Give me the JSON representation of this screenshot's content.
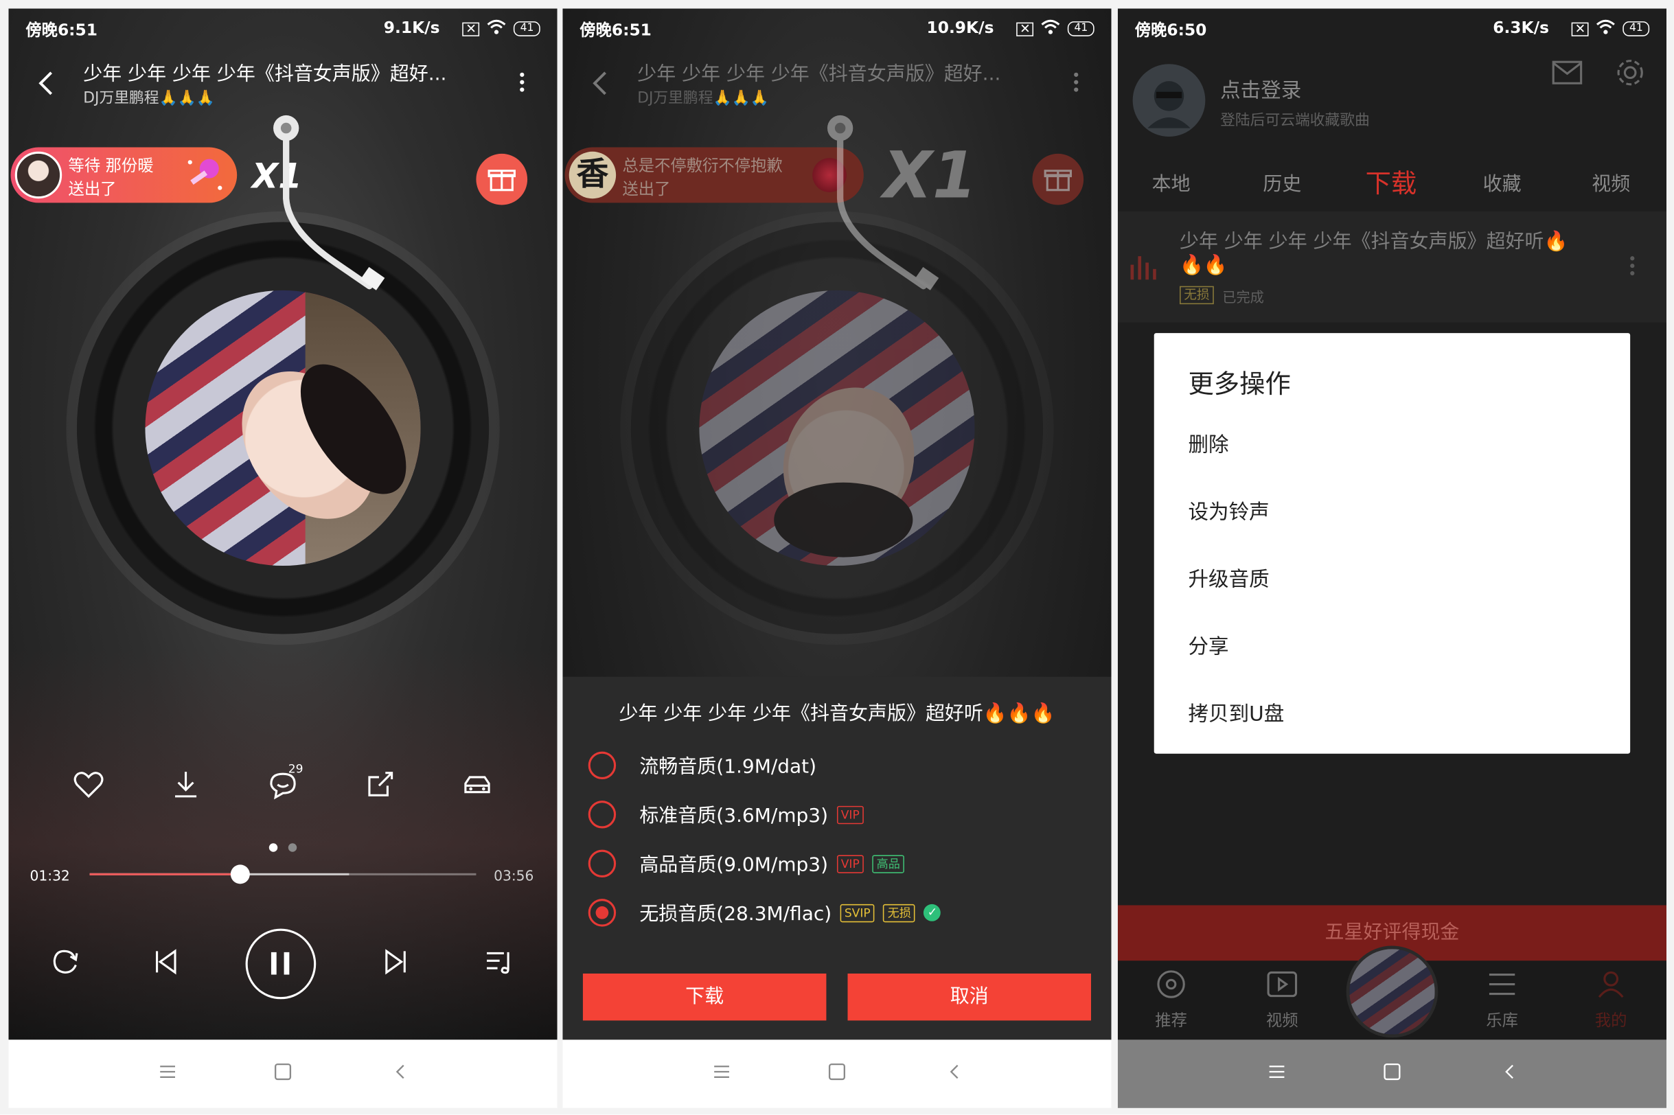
{
  "panel1": {
    "status": {
      "time": "傍晚6:51",
      "speed": "9.1K/s",
      "battery": "41"
    },
    "song_title": "少年 少年 少年 少年《抖音女声版》超好...",
    "artist": "DJ万里鹏程🙏🙏🙏",
    "gift": {
      "line1": "等待  那份暖",
      "line2": "送出了",
      "multiplier": "X1"
    },
    "comment_count": "29",
    "time_current": "01:32",
    "time_total": "03:56",
    "progress": 0.39,
    "buffer": 0.67,
    "icons": {
      "back": "back-arrow-icon",
      "more": "more-vertical-icon",
      "gift": "gift-box-icon",
      "like": "heart-icon",
      "download": "download-icon",
      "comment": "comment-icon",
      "share": "share-icon",
      "car": "car-icon",
      "repeat": "repeat-icon",
      "prev": "previous-icon",
      "pause": "pause-icon",
      "next": "next-icon",
      "playlist": "playlist-icon"
    }
  },
  "panel2": {
    "status": {
      "time": "傍晚6:51",
      "speed": "10.9K/s",
      "battery": "41"
    },
    "song_title": "少年 少年 少年 少年《抖音女声版》超好...",
    "artist": "DJ万里鹏程🙏🙏🙏",
    "gift": {
      "line1": "总是不停敷衍不停抱歉",
      "line2": "送出了",
      "avatar_char": "香",
      "multiplier": "X1"
    },
    "sheet_title": "少年 少年 少年 少年《抖音女声版》超好听🔥🔥🔥",
    "options": [
      {
        "label": "流畅音质(1.9M/dat)",
        "selected": false
      },
      {
        "label": "标准音质(3.6M/mp3)",
        "tag1": "VIP",
        "selected": false
      },
      {
        "label": "高品音质(9.0M/mp3)",
        "tag1": "VIP",
        "tag2": "高品",
        "selected": false
      },
      {
        "label": "无损音质(28.3M/flac)",
        "tag1": "SVIP",
        "tag2": "无损",
        "selected": true
      }
    ],
    "btn_download": "下载",
    "btn_cancel": "取消"
  },
  "panel3": {
    "status": {
      "time": "傍晚6:50",
      "speed": "6.3K/s",
      "battery": "41"
    },
    "login_title": "点击登录",
    "login_sub": "登陆后可云端收藏歌曲",
    "tabs": [
      "本地",
      "历史",
      "下载",
      "收藏",
      "视频"
    ],
    "active_tab": "下载",
    "song": {
      "title": "少年 少年 少年 少年《抖音女声版》超好听🔥",
      "title2": "🔥🔥",
      "tag": "无损",
      "status": "已完成"
    },
    "dialog": {
      "title": "更多操作",
      "items": [
        "删除",
        "设为铃声",
        "升级音质",
        "分享",
        "拷贝到U盘"
      ]
    },
    "banner": "五星好评得现金",
    "bottom_nav": [
      "推荐",
      "视频",
      "乐库",
      "我的"
    ],
    "colors": {
      "accent": "#d8322a"
    }
  }
}
